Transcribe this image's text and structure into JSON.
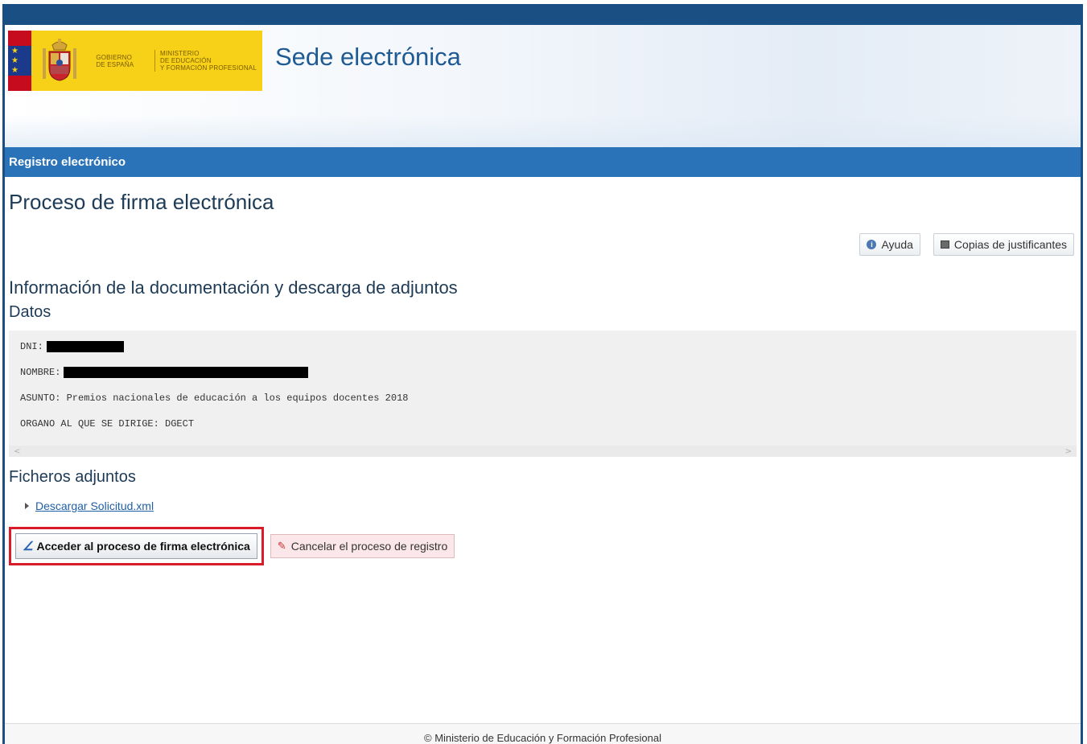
{
  "header": {
    "logo_gobierno_lines": [
      "GOBIERNO",
      "DE ESPAÑA"
    ],
    "logo_ministerio_lines": [
      "MINISTERIO",
      "DE EDUCACIÓN",
      "Y FORMACIÓN PROFESIONAL"
    ],
    "site_title": "Sede electrónica"
  },
  "section_bar": {
    "label": "Registro electrónico"
  },
  "page": {
    "title": "Proceso de firma electrónica",
    "tools": {
      "help_label": "Ayuda",
      "copies_label": "Copias de justificantes"
    },
    "info_title": "Información de la documentación y descarga de adjuntos",
    "datos_title": "Datos",
    "data": {
      "dni_label": "DNI:",
      "nombre_label": "NOMBRE:",
      "asunto": "ASUNTO: Premios nacionales de educación a los equipos docentes 2018",
      "organo": "ORGANO AL QUE SE DIRIGE: DGECT"
    },
    "files_title": "Ficheros adjuntos",
    "download_link": "Descargar Solicitud.xml",
    "actions": {
      "sign_label": "Acceder al proceso de firma electrónica",
      "cancel_label": "Cancelar el proceso de registro"
    }
  },
  "footer": {
    "text": "© Ministerio de Educación y Formación Profesional"
  },
  "colors": {
    "top_bar": "#1a4f84",
    "section_bar": "#2a73b8",
    "logo_bg": "#f7d117",
    "highlight_border": "#d91b2a",
    "link": "#1f5fa6"
  }
}
